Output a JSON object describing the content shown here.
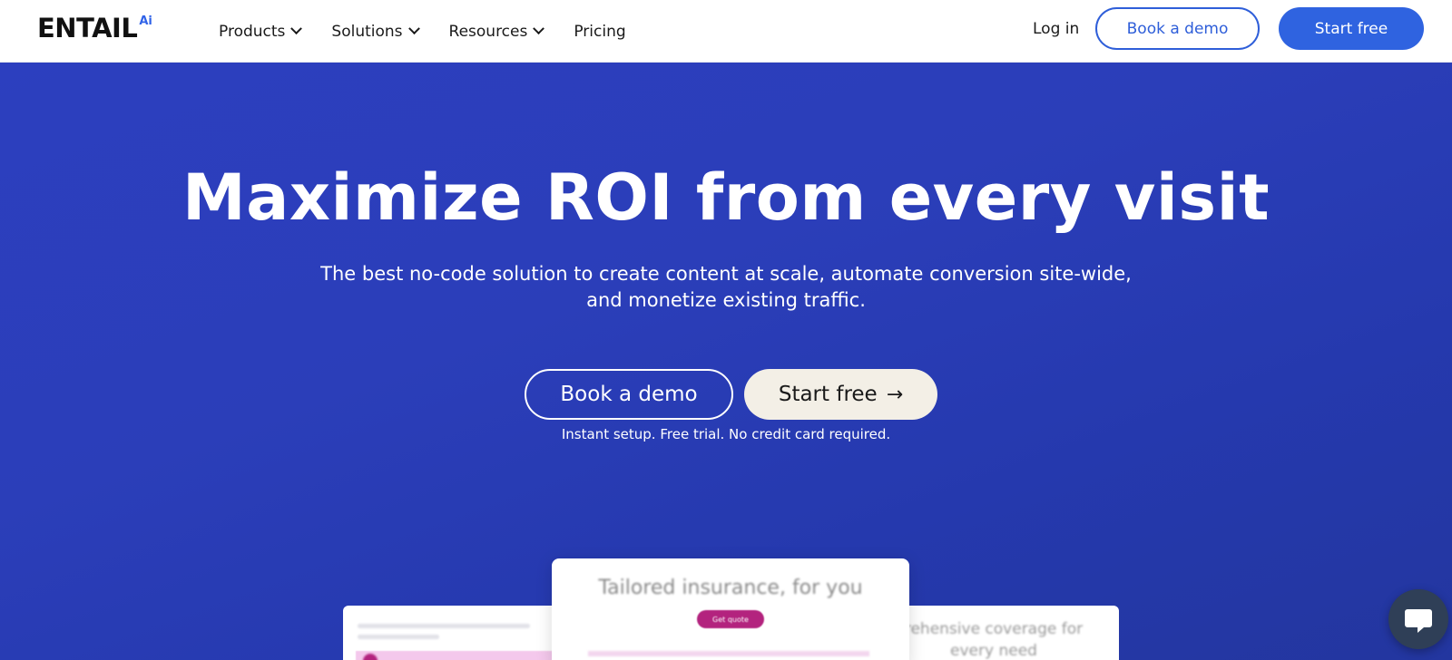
{
  "brand": {
    "logo_word": "ENTAIL",
    "logo_suffix": "Ai",
    "accent": "#2f63e0"
  },
  "nav": {
    "items": [
      {
        "label": "Products",
        "has_dropdown": true
      },
      {
        "label": "Solutions",
        "has_dropdown": true
      },
      {
        "label": "Resources",
        "has_dropdown": true
      },
      {
        "label": "Pricing",
        "has_dropdown": false
      }
    ],
    "login_label": "Log in",
    "book_demo_label": "Book a demo",
    "start_free_label": "Start free"
  },
  "hero": {
    "title": "Maximize ROI from every visit",
    "subtitle_line1": "The best no-code solution to create content at scale, automate conversion site-wide,",
    "subtitle_line2": "and monetize existing traffic.",
    "book_demo_label": "Book a demo",
    "start_free_label": "Start free",
    "start_free_arrow": "→",
    "note": "Instant setup. Free trial. No credit card required.",
    "background": "#2b3eb9"
  },
  "preview": {
    "center_title": "Tailored insurance, for you",
    "center_button": "Get quote",
    "right_text_line1": "rehensive coverage for",
    "right_text_line2": "every need"
  },
  "chat": {
    "icon": "chat-bubble-icon",
    "bg": "#2f3f57"
  }
}
